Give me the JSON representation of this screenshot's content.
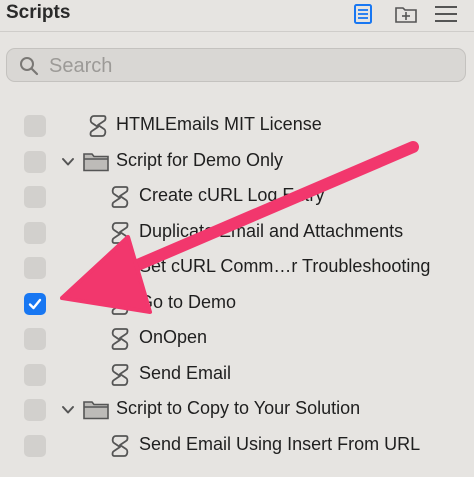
{
  "panel": {
    "title": "Scripts"
  },
  "toolbar": {
    "icons": [
      "script-list-icon",
      "new-folder-icon",
      "menu-icon"
    ]
  },
  "search": {
    "placeholder": "Search",
    "value": ""
  },
  "items": [
    {
      "type": "script",
      "level": 0,
      "label": "HTMLEmails MIT License",
      "checked": false
    },
    {
      "type": "folder",
      "level": 0,
      "label": "Script for Demo Only",
      "expanded": true,
      "checked": false
    },
    {
      "type": "script",
      "level": 1,
      "label": "Create cURL Log Entry",
      "checked": false
    },
    {
      "type": "script",
      "level": 1,
      "label": "Duplicate Email and Attachments",
      "checked": false
    },
    {
      "type": "script",
      "level": 1,
      "label": "Set cURL Comm…r Troubleshooting",
      "checked": false
    },
    {
      "type": "script",
      "level": 1,
      "label": "Go to Demo",
      "checked": true
    },
    {
      "type": "script",
      "level": 1,
      "label": "OnOpen",
      "checked": false
    },
    {
      "type": "script",
      "level": 1,
      "label": "Send Email",
      "checked": false
    },
    {
      "type": "folder",
      "level": 0,
      "label": "Script to Copy to Your Solution",
      "expanded": true,
      "checked": false
    },
    {
      "type": "script",
      "level": 1,
      "label": "Send Email Using Insert From URL",
      "checked": false
    }
  ],
  "colors": {
    "accent": "#1877f2",
    "arrow": "#f2376d",
    "background": "#e6e4e1"
  }
}
